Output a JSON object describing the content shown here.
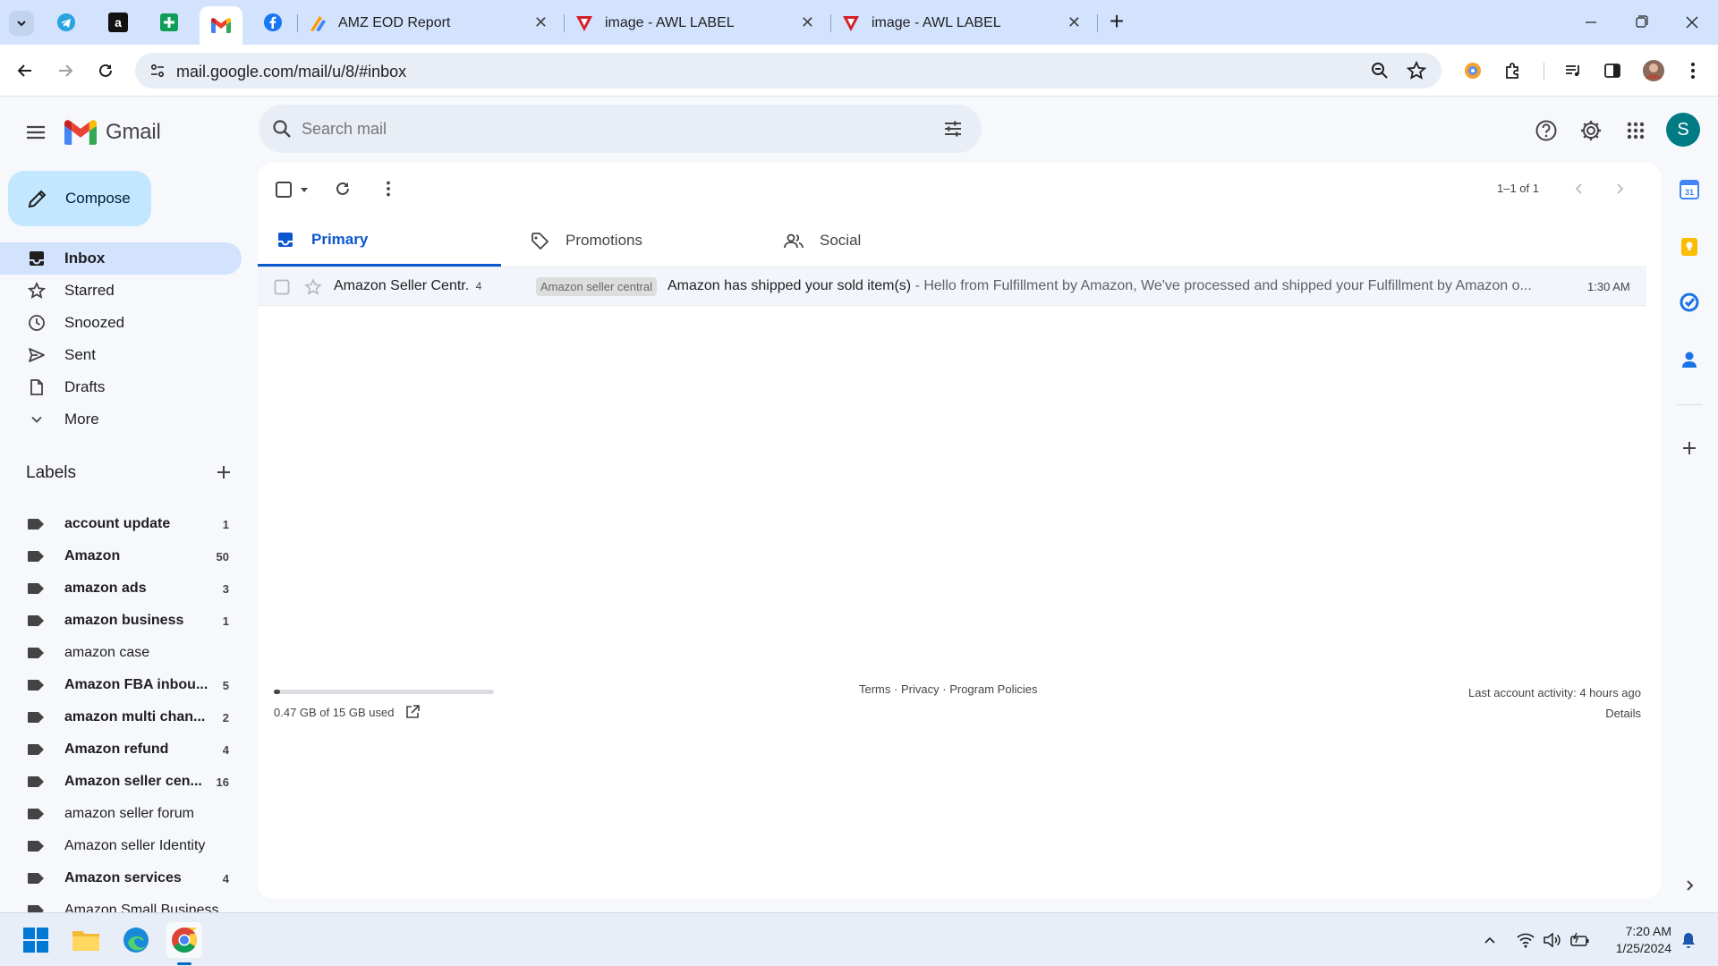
{
  "browser": {
    "tabs": [
      {
        "title": "AMZ EOD Report"
      },
      {
        "title": "image - AWL LABEL"
      },
      {
        "title": "image - AWL LABEL"
      }
    ],
    "close_glyph": "✕",
    "new_tab_glyph": "+",
    "url": "mail.google.com/mail/u/8/#inbox"
  },
  "gmail": {
    "logo_text": "Gmail",
    "search_placeholder": "Search mail",
    "avatar_letter": "S",
    "compose_label": "Compose",
    "nav": [
      {
        "label": "Inbox",
        "icon": "inbox-icon"
      },
      {
        "label": "Starred",
        "icon": "star-icon"
      },
      {
        "label": "Snoozed",
        "icon": "clock-icon"
      },
      {
        "label": "Sent",
        "icon": "send-icon"
      },
      {
        "label": "Drafts",
        "icon": "draft-icon"
      },
      {
        "label": "More",
        "icon": "chevron-down-icon"
      }
    ],
    "labels_heading": "Labels",
    "labels": [
      {
        "name": "account update",
        "count": "1",
        "bold": true
      },
      {
        "name": "Amazon",
        "count": "50",
        "bold": true
      },
      {
        "name": "amazon ads",
        "count": "3",
        "bold": true
      },
      {
        "name": "amazon business",
        "count": "1",
        "bold": true
      },
      {
        "name": "amazon case",
        "count": "",
        "bold": false
      },
      {
        "name": "Amazon FBA inbou...",
        "count": "5",
        "bold": true
      },
      {
        "name": "amazon multi chan...",
        "count": "2",
        "bold": true
      },
      {
        "name": "Amazon refund",
        "count": "4",
        "bold": true
      },
      {
        "name": "Amazon seller cen...",
        "count": "16",
        "bold": true
      },
      {
        "name": "amazon seller forum",
        "count": "",
        "bold": false
      },
      {
        "name": "Amazon seller Identity",
        "count": "",
        "bold": false
      },
      {
        "name": "Amazon services",
        "count": "4",
        "bold": true
      },
      {
        "name": "Amazon Small Business",
        "count": "",
        "bold": false
      }
    ],
    "pagination": "1–1 of 1",
    "categories": [
      {
        "label": "Primary",
        "icon": "inbox-icon"
      },
      {
        "label": "Promotions",
        "icon": "tag-icon"
      },
      {
        "label": "Social",
        "icon": "people-icon"
      }
    ],
    "email": {
      "sender": "Amazon Seller Centr.",
      "thread_count": "4",
      "label_chip": "Amazon seller central",
      "subject": "Amazon has shipped your sold item(s)",
      "snippet": " - Hello from Fulfillment by Amazon, We've processed and shipped your Fulfillment by Amazon o...",
      "time": "1:30 AM"
    },
    "footer": {
      "storage": "0.47 GB of 15 GB used",
      "storage_fraction": 0.03,
      "terms": "Terms",
      "privacy": "Privacy",
      "policies": "Program Policies",
      "separator": "·",
      "last_activity": "Last account activity: 4 hours ago",
      "details": "Details"
    }
  },
  "taskbar": {
    "time": "7:20 AM",
    "date": "1/25/2024"
  },
  "colors": {
    "accent": "#0b57d0",
    "compose_bg": "#c2e7ff",
    "selected_nav": "#d3e3fd",
    "avatar": "#007b83"
  }
}
